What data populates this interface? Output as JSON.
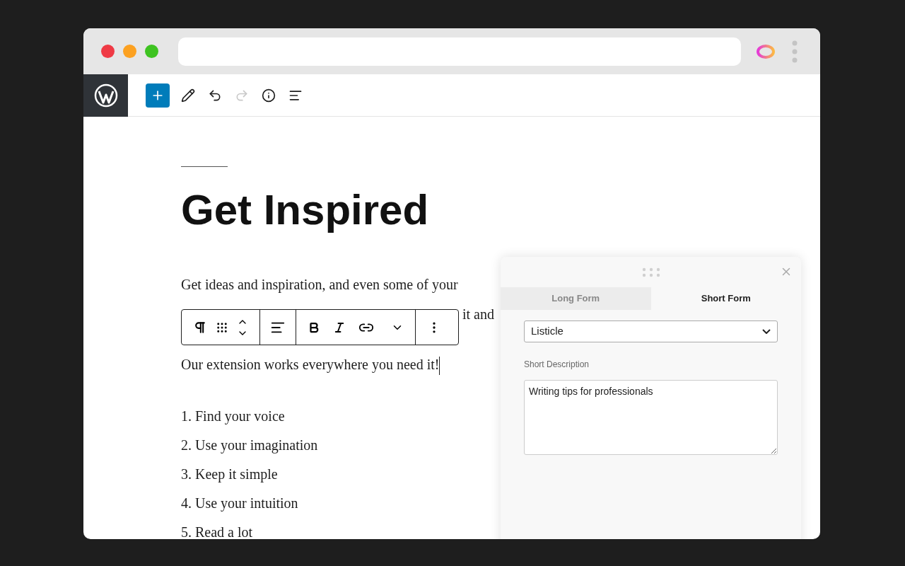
{
  "editor_toolbar": {
    "tools": [
      {
        "kind": "add",
        "disabled": false
      },
      {
        "kind": "edit",
        "disabled": false
      },
      {
        "kind": "undo",
        "disabled": false
      },
      {
        "kind": "redo",
        "disabled": true
      },
      {
        "kind": "info",
        "disabled": false
      },
      {
        "kind": "outline",
        "disabled": false
      }
    ]
  },
  "post": {
    "title": "Get Inspired",
    "paragraph_lines": [
      "Get ideas and inspiration, and even some of your",
      "it and"
    ],
    "second_paragraph": "Our extension works everywhere you need it!",
    "list": [
      "1. Find your voice",
      "2. Use your imagination",
      "3. Keep it simple",
      "4. Use your intuition",
      "5. Read a lot"
    ]
  },
  "panel": {
    "tabs": [
      {
        "label": "Long Form",
        "selected": false
      },
      {
        "label": "Short Form",
        "selected": true
      }
    ],
    "select": {
      "value": "Listicle"
    },
    "description": {
      "label": "Short Description",
      "value": "Writing tips for professionals"
    }
  }
}
